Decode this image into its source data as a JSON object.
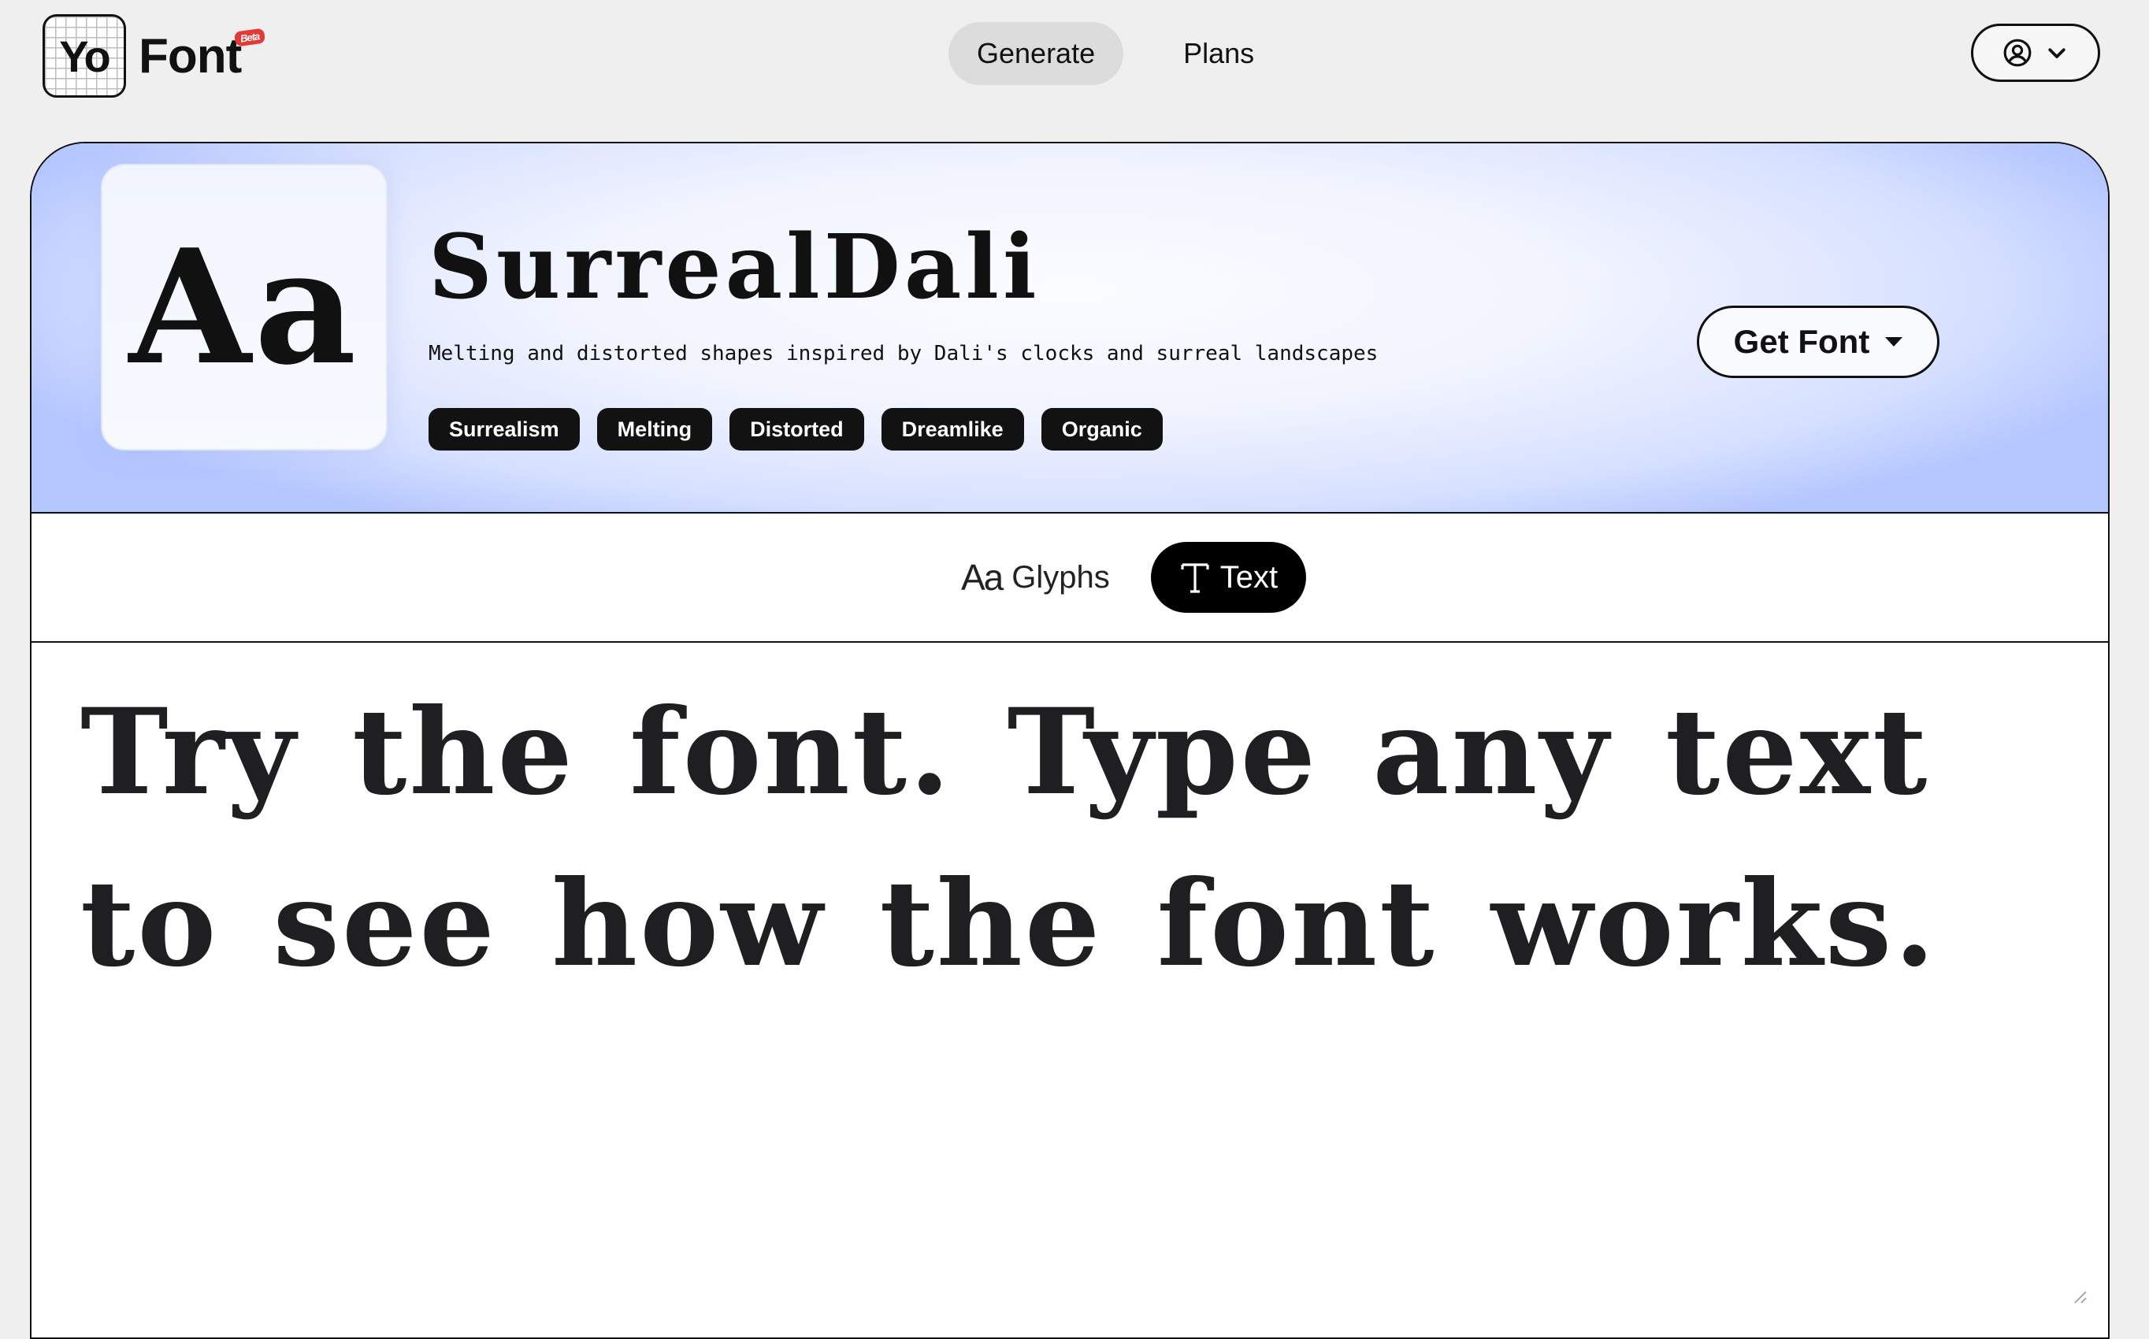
{
  "header": {
    "logo_yo": "Yo",
    "logo_word": "Font",
    "beta": "Beta",
    "nav": [
      {
        "label": "Generate",
        "active": true
      },
      {
        "label": "Plans",
        "active": false
      }
    ],
    "account_icon": "user-circle-icon"
  },
  "hero": {
    "preview_glyphs": "Aa",
    "font_name": "SurrealDali",
    "description": "Melting and distorted shapes inspired by Dali's clocks and surreal landscapes",
    "tags": [
      "Surrealism",
      "Melting",
      "Distorted",
      "Dreamlike",
      "Organic"
    ],
    "get_font_label": "Get Font"
  },
  "mode_toggle": {
    "glyphs_icon": "Aa",
    "glyphs_label": "Glyphs",
    "text_icon": "T",
    "text_label": "Text",
    "active": "text"
  },
  "tester": {
    "text": "Try the font. Type any text to see how the font works."
  },
  "colors": {
    "background": "#efefef",
    "hero_gradient_edge": "#b4c6ff",
    "tag_bg": "#121212",
    "active_toggle": "#000000",
    "beta_badge": "#e53935"
  }
}
